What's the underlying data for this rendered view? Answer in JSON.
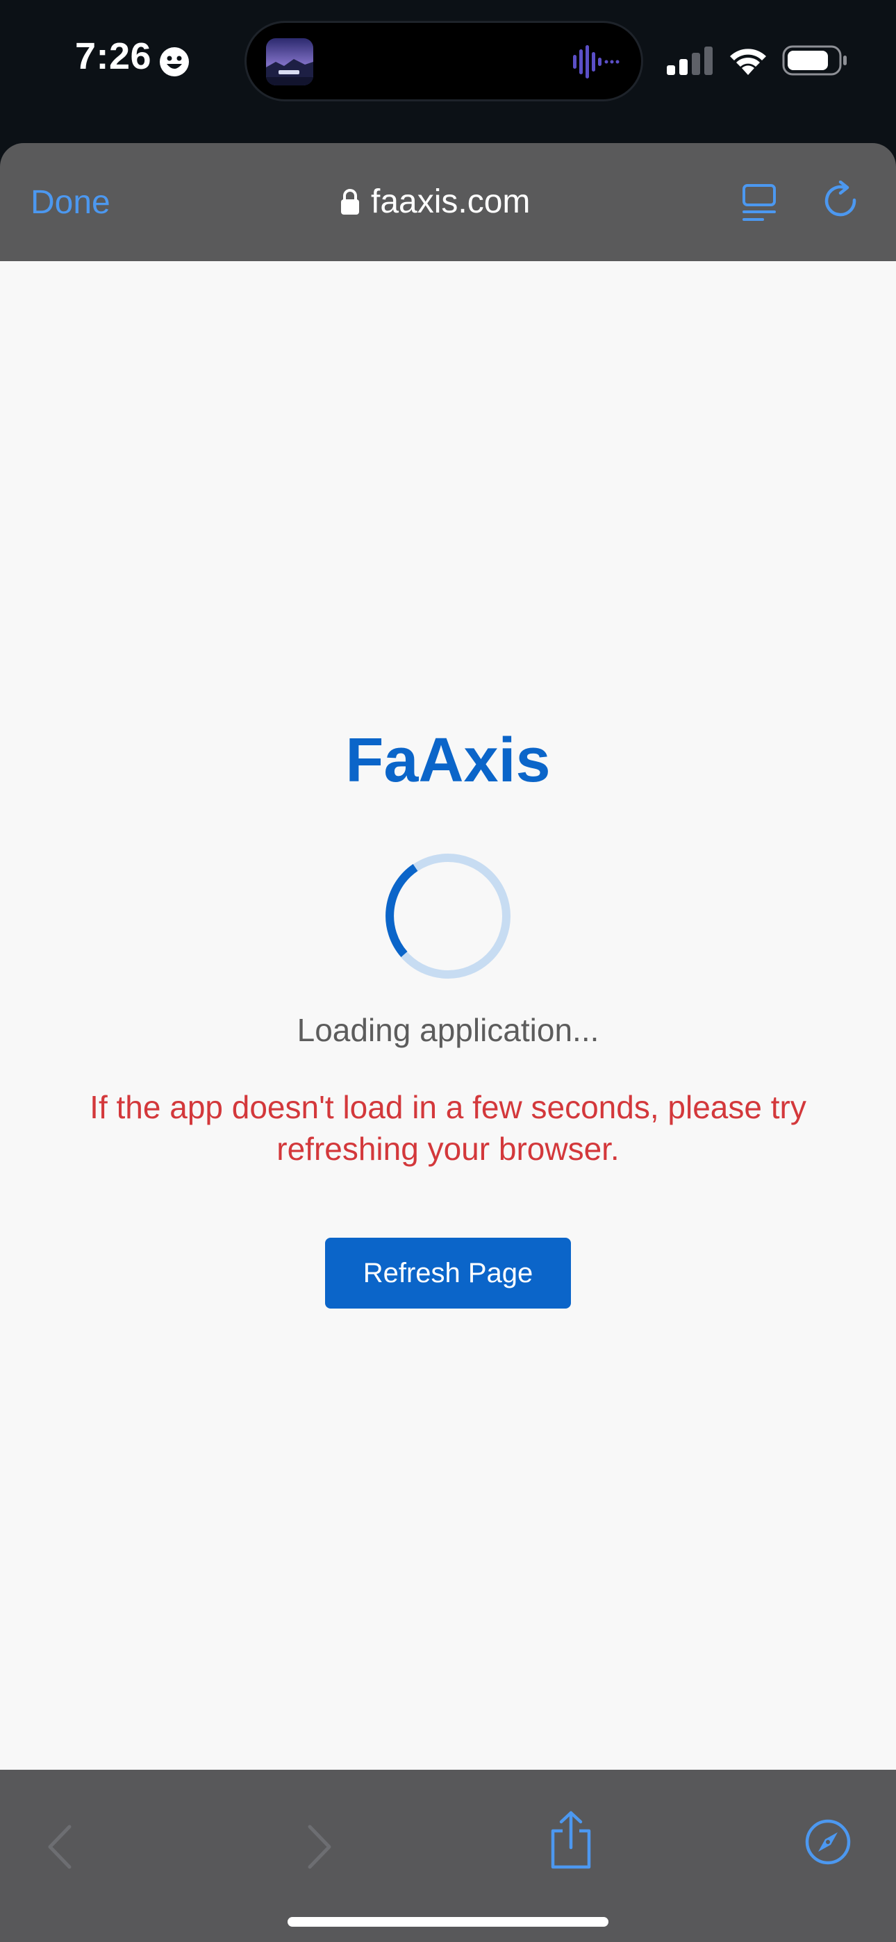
{
  "status_bar": {
    "time": "7:26",
    "icons": [
      "smiley-icon",
      "album-art",
      "audio-wave-icon",
      "cellular-signal-icon",
      "wifi-icon",
      "battery-icon"
    ]
  },
  "browser": {
    "done_label": "Done",
    "url": "faaxis.com",
    "icons": [
      "lock-icon",
      "reader-mode-icon",
      "reload-icon"
    ]
  },
  "page": {
    "title": "FaAxis",
    "loading_text": "Loading application...",
    "warning_text": "If the app doesn't load in a few seconds, please try refreshing your browser.",
    "refresh_button": "Refresh Page"
  },
  "bottom_bar": {
    "icons": [
      "back-chevron-icon",
      "forward-chevron-icon",
      "share-icon",
      "compass-icon"
    ]
  },
  "colors": {
    "accent": "#0b65c9",
    "link_blue": "#4c98f0",
    "warning": "#d3383b",
    "toolbar_bg": "#5a5a5b",
    "page_bg": "#f8f8f8"
  }
}
